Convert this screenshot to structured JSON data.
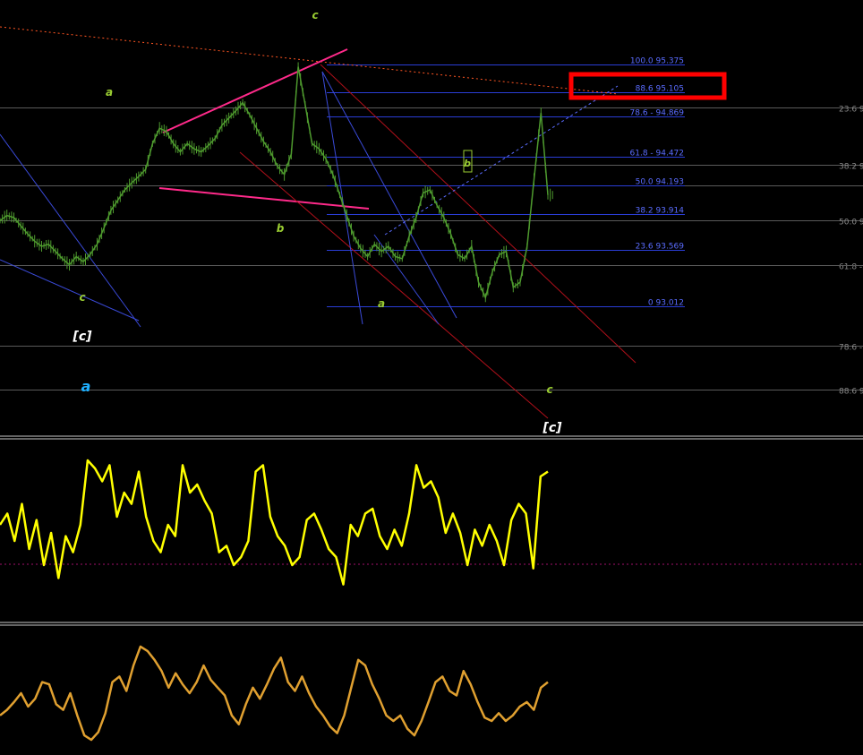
{
  "colors": {
    "background": "#000000",
    "fib_line": "#2a3dd6",
    "fib_label": "#5a6cff",
    "gray_level": "#5a5a5a",
    "gray_label": "#8a8a8a",
    "price": "#4e9a2e",
    "wave_label": "#9acd32",
    "alt_label_blue": "#1fb0ff",
    "bracket_label": "#ffffff",
    "magenta": "#ff2a8a",
    "red_channel": "#b0101a",
    "highlight": "#ff0000",
    "osc1": "#ffff00",
    "osc2": "#e0a030",
    "separator": "#c8c8c8"
  },
  "fib_levels": [
    {
      "label": "100.0 95.375",
      "price": 95.375
    },
    {
      "label": "88.6 95.105",
      "price": 95.105
    },
    {
      "label": "78.6 - 94.869",
      "price": 94.869
    },
    {
      "label": "61.8 - 94.472",
      "price": 94.472
    },
    {
      "label": "50.0 94.193",
      "price": 94.193
    },
    {
      "label": "38.2 93.914",
      "price": 93.914
    },
    {
      "label": "23.6 93.569",
      "price": 93.569
    },
    {
      "label": "0 93.012",
      "price": 93.012
    }
  ],
  "right_levels": [
    {
      "label": "23.6 9",
      "price": 94.95
    },
    {
      "label": "38.2 9",
      "price": 94.39
    },
    {
      "label": "50.0 9",
      "price": 93.85
    },
    {
      "label": "61.8 - 9",
      "price": 93.42
    },
    {
      "label": "78.6 - 9",
      "price": 92.63
    },
    {
      "label": "88.6 9",
      "price": 92.2
    }
  ],
  "mid_levels": [
    {
      "price": 94.19
    },
    {
      "price": 93.42
    }
  ],
  "wave_labels": {
    "c_top": "c",
    "a_left": "a",
    "b_mid": "b",
    "c_left": "c",
    "a_mid": "a",
    "c_right": "c",
    "bracket_c_left": "[c]",
    "bracket_c_right": "[c]",
    "alt_a": "a",
    "b_box": "b"
  },
  "chart_data": [
    {
      "type": "line",
      "series": [
        {
          "values": [
            93.85,
            93.9,
            93.88,
            93.8,
            93.72,
            93.65,
            93.6,
            93.62,
            93.55,
            93.48,
            93.42,
            93.5,
            93.45,
            93.52,
            93.62,
            93.78,
            93.95,
            94.05,
            94.15,
            94.22,
            94.28,
            94.35,
            94.6,
            94.75,
            94.72,
            94.6,
            94.52,
            94.6,
            94.55,
            94.52,
            94.58,
            94.65,
            94.78,
            94.85,
            94.92,
            95.0,
            94.88,
            94.75,
            94.62,
            94.52,
            94.38,
            94.3,
            94.5,
            95.35,
            94.98,
            94.6,
            94.55,
            94.45,
            94.3,
            94.1,
            93.9,
            93.7,
            93.58,
            93.5,
            93.62,
            93.55,
            93.6,
            93.5,
            93.48,
            93.7,
            93.88,
            94.12,
            94.15,
            94.0,
            93.88,
            93.72,
            93.52,
            93.48,
            93.6,
            93.25,
            93.1,
            93.35,
            93.52,
            93.55,
            93.2,
            93.25,
            93.6,
            94.25,
            94.9,
            94.1
          ]
        }
      ],
      "title": "",
      "xlabel": "",
      "ylabel": "",
      "ylim": [
        91.75,
        96.0
      ],
      "grid": false
    },
    {
      "type": "line",
      "series": [
        {
          "values": [
            0.55,
            0.62,
            0.45,
            0.68,
            0.4,
            0.58,
            0.3,
            0.5,
            0.22,
            0.48,
            0.38,
            0.55,
            0.95,
            0.9,
            0.82,
            0.92,
            0.6,
            0.75,
            0.68,
            0.88,
            0.6,
            0.45,
            0.38,
            0.55,
            0.48,
            0.92,
            0.75,
            0.8,
            0.7,
            0.62,
            0.38,
            0.42,
            0.3,
            0.35,
            0.45,
            0.88,
            0.92,
            0.6,
            0.48,
            0.42,
            0.3,
            0.35,
            0.58,
            0.62,
            0.52,
            0.4,
            0.35,
            0.18,
            0.55,
            0.48,
            0.62,
            0.65,
            0.48,
            0.4,
            0.52,
            0.42,
            0.62,
            0.92,
            0.78,
            0.82,
            0.72,
            0.5,
            0.62,
            0.5,
            0.3,
            0.52,
            0.42,
            0.55,
            0.45,
            0.3,
            0.58,
            0.68,
            0.62,
            0.28,
            0.85,
            0.88
          ]
        }
      ],
      "title": "",
      "xlabel": "",
      "ylabel": "",
      "ylim": [
        0,
        1
      ],
      "grid": false
    },
    {
      "type": "line",
      "series": [
        {
          "values": [
            0.3,
            0.35,
            0.42,
            0.5,
            0.38,
            0.45,
            0.6,
            0.58,
            0.4,
            0.35,
            0.5,
            0.3,
            0.12,
            0.08,
            0.15,
            0.32,
            0.6,
            0.65,
            0.52,
            0.75,
            0.92,
            0.88,
            0.8,
            0.7,
            0.55,
            0.68,
            0.58,
            0.5,
            0.6,
            0.75,
            0.62,
            0.55,
            0.48,
            0.3,
            0.22,
            0.4,
            0.55,
            0.45,
            0.58,
            0.72,
            0.82,
            0.6,
            0.52,
            0.65,
            0.5,
            0.38,
            0.3,
            0.2,
            0.14,
            0.3,
            0.55,
            0.8,
            0.75,
            0.58,
            0.45,
            0.3,
            0.25,
            0.3,
            0.18,
            0.12,
            0.25,
            0.42,
            0.6,
            0.65,
            0.52,
            0.48,
            0.7,
            0.58,
            0.42,
            0.28,
            0.25,
            0.32,
            0.25,
            0.3,
            0.38,
            0.42,
            0.35,
            0.55,
            0.6
          ]
        }
      ],
      "title": "",
      "xlabel": "",
      "ylabel": "",
      "ylim": [
        0,
        1
      ],
      "grid": false
    }
  ]
}
